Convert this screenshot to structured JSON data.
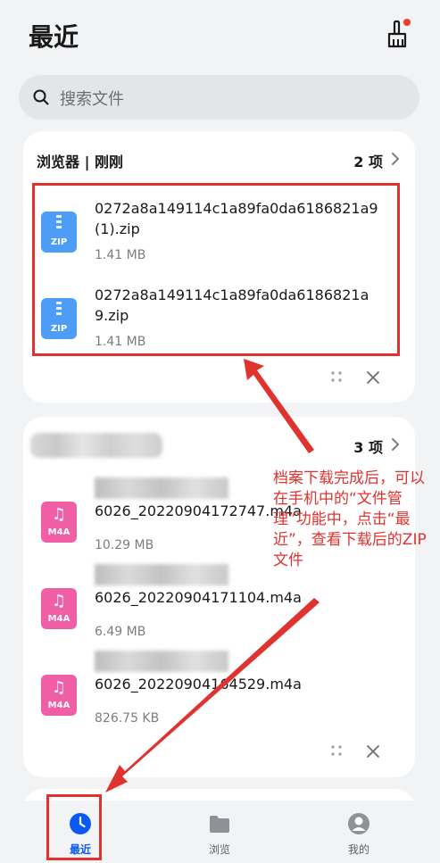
{
  "header": {
    "title": "最近",
    "clean_icon": "broom-icon"
  },
  "search": {
    "placeholder": "搜索文件",
    "icon": "search-icon"
  },
  "cards": [
    {
      "title": "浏览器 | 刚刚",
      "count": "2 项",
      "files": [
        {
          "name": "0272a8a149114c1a89fa0da6186821a9(1).zip",
          "size": "1.41 MB",
          "type_tag": "ZIP"
        },
        {
          "name": "0272a8a149114c1a89fa0da6186821a9.zip",
          "size": "1.41 MB",
          "type_tag": "ZIP"
        }
      ]
    },
    {
      "title": "",
      "count": "3 项",
      "files": [
        {
          "name": "6026_20220904172747.m4a",
          "size": "10.29 MB",
          "type_tag": "M4A"
        },
        {
          "name": "6026_20220904171104.m4a",
          "size": "6.49 MB",
          "type_tag": "M4A"
        },
        {
          "name": "6026_20220904164529.m4a",
          "size": "826.75 KB",
          "type_tag": "M4A"
        }
      ]
    }
  ],
  "annotation": "档案下载完成后，可以在手机中的“文件管理”功能中，点击“最近”，查看下载后的ZIP文件",
  "tabs": [
    {
      "label": "最近",
      "icon": "clock-icon",
      "active": true
    },
    {
      "label": "浏览",
      "icon": "folder-icon",
      "active": false
    },
    {
      "label": "我的",
      "icon": "profile-icon",
      "active": false
    }
  ],
  "colors": {
    "accent": "#0a59f7",
    "annotation_red": "#e0322f",
    "zip": "#4d9cf5",
    "m4a": "#f05fa6"
  }
}
